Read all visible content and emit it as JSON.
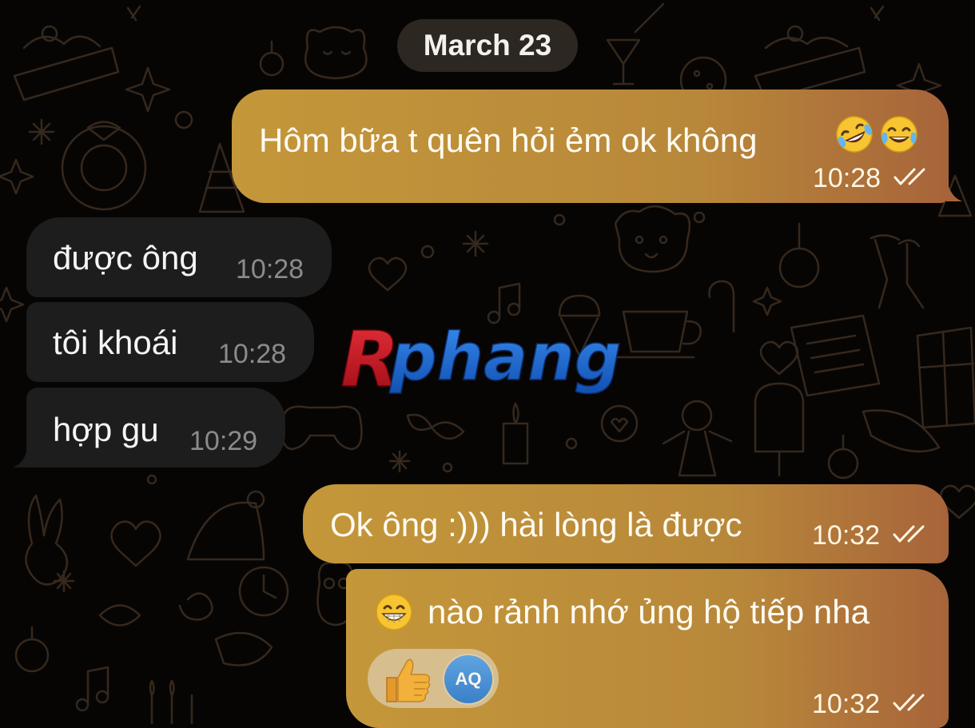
{
  "date_separator": "March 23",
  "messages": [
    {
      "direction": "outgoing",
      "text": "Hôm bữa t quên hỏi ẻm ok không",
      "emoji": [
        "rolling-on-floor-laughing",
        "face-with-tears-of-joy"
      ],
      "time": "10:28",
      "status": "read"
    },
    {
      "direction": "incoming",
      "text": "được ông",
      "time": "10:28"
    },
    {
      "direction": "incoming",
      "text": "tôi khoái",
      "time": "10:28"
    },
    {
      "direction": "incoming",
      "text": "hợp gu",
      "time": "10:29"
    },
    {
      "direction": "outgoing",
      "text": "Ok ông :))) hài lòng là được",
      "time": "10:32",
      "status": "read"
    },
    {
      "direction": "outgoing",
      "text": "nào rảnh nhớ ủng hộ tiếp nha",
      "emoji_leading": "grinning-face-with-smiling-eyes",
      "time": "10:32",
      "status": "read",
      "reaction": {
        "emoji": "thumbs-up",
        "user_initials": "AQ"
      }
    }
  ],
  "watermark": "Rphang",
  "colors": {
    "background": "#070504",
    "outgoing_bubble_start": "#c4973a",
    "outgoing_bubble_end": "#a7643a",
    "incoming_bubble": "#1d1d1d",
    "date_pill": "#2c2721",
    "avatar": "#3b8ae0",
    "watermark_red": "#c8101e",
    "watermark_blue": "#1560c8"
  },
  "icons": [
    "double-check-icon",
    "thumbs-up-icon",
    "background-doodle-pattern"
  ]
}
